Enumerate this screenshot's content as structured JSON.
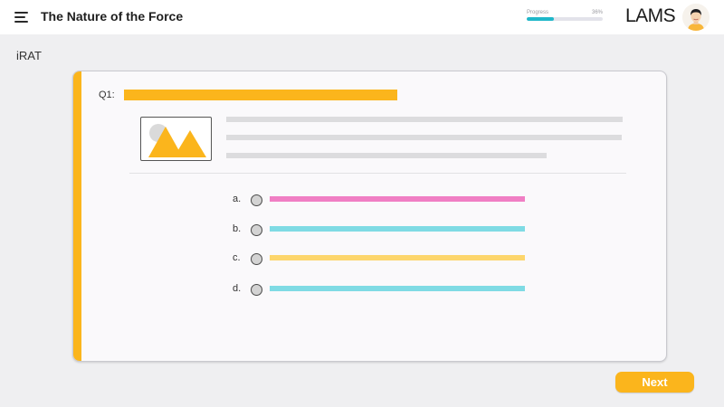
{
  "header": {
    "title": "The Nature of the Force",
    "menu_icon": "hamburger-menu-icon",
    "progress": {
      "label": "Progress",
      "percent_text": "36%",
      "value": 0.36,
      "color": "#1fb7c9"
    },
    "logo": "LAMS",
    "avatar_icon": "user-avatar-icon"
  },
  "section": {
    "label": "iRAT"
  },
  "question": {
    "label": "Q1:",
    "accent_color": "#fbb51c",
    "image_icon": "image-placeholder-icon",
    "options": [
      {
        "letter": "a.",
        "color": "#f07fc4"
      },
      {
        "letter": "b.",
        "color": "#7fdbe4"
      },
      {
        "letter": "c.",
        "color": "#fdd66c"
      },
      {
        "letter": "d.",
        "color": "#7fdbe4"
      }
    ]
  },
  "footer": {
    "next_label": "Next"
  }
}
